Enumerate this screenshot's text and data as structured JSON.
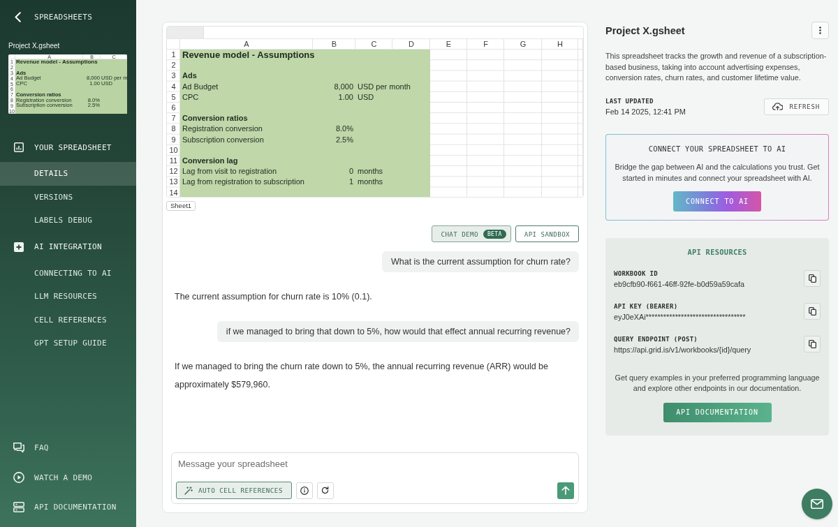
{
  "sidebar": {
    "back_link": "SPREADSHEETS",
    "file_name": "Project X.gsheet",
    "thumbnail": {
      "columns": [
        "A",
        "B",
        "C"
      ],
      "rows": [
        {
          "number": "1",
          "kind": "title",
          "label": "Revenue model - Assumptions"
        },
        {
          "number": "2",
          "kind": "blank"
        },
        {
          "number": "3",
          "kind": "heading",
          "label": "Ads"
        },
        {
          "number": "4",
          "kind": "item",
          "label": "Ad Budget",
          "value": "8,000",
          "unit": "USD per m"
        },
        {
          "number": "5",
          "kind": "item",
          "label": "CPC",
          "value": "1.00",
          "unit": "USD"
        },
        {
          "number": "6",
          "kind": "blank"
        },
        {
          "number": "7",
          "kind": "heading",
          "label": "Conversion ratios"
        },
        {
          "number": "8",
          "kind": "item",
          "label": "Registration conversion",
          "value": "8.0%"
        },
        {
          "number": "9",
          "kind": "item",
          "label": "Subscription conversion",
          "value": "2.5%"
        },
        {
          "number": "10",
          "kind": "blank"
        }
      ]
    },
    "sections": [
      {
        "label": "YOUR SPREADSHEET",
        "children": [
          {
            "label": "DETAILS",
            "selected": true
          },
          {
            "label": "VERSIONS",
            "selected": false
          },
          {
            "label": "LABELS DEBUG",
            "selected": false
          }
        ]
      },
      {
        "label": "AI INTEGRATION",
        "children": [
          {
            "label": "CONNECTING TO AI",
            "selected": false
          },
          {
            "label": "LLM RESOURCES",
            "selected": false
          },
          {
            "label": "CELL REFERENCES",
            "selected": false
          },
          {
            "label": "GPT SETUP GUIDE",
            "selected": false
          }
        ]
      }
    ],
    "footer_links": [
      {
        "label": "FAQ"
      },
      {
        "label": "WATCH A DEMO"
      },
      {
        "label": "API DOCUMENTATION"
      }
    ]
  },
  "sheet": {
    "columns": [
      "A",
      "B",
      "C",
      "D",
      "E",
      "F",
      "G",
      "H"
    ],
    "rows": [
      {
        "number": "1",
        "kind": "title",
        "label": "Revenue model - Assumptions"
      },
      {
        "number": "2",
        "kind": "blank"
      },
      {
        "number": "3",
        "kind": "heading",
        "label": "Ads"
      },
      {
        "number": "4",
        "kind": "item",
        "label": "Ad Budget",
        "value": "8,000",
        "unit": "USD per month"
      },
      {
        "number": "5",
        "kind": "item",
        "label": "CPC",
        "value": "1.00",
        "unit": "USD"
      },
      {
        "number": "6",
        "kind": "blank"
      },
      {
        "number": "7",
        "kind": "heading",
        "label": "Conversion ratios"
      },
      {
        "number": "8",
        "kind": "item",
        "label": "Registration conversion",
        "value": "8.0%"
      },
      {
        "number": "9",
        "kind": "item",
        "label": "Subscription conversion",
        "value": "2.5%"
      },
      {
        "number": "10",
        "kind": "blank"
      },
      {
        "number": "11",
        "kind": "heading",
        "label": "Conversion lag"
      },
      {
        "number": "12",
        "kind": "item",
        "label": "Lag from visit to registration",
        "value": "0",
        "unit": "months"
      },
      {
        "number": "13",
        "kind": "item",
        "label": "Lag from registration to subscription",
        "value": "1",
        "unit": "months"
      },
      {
        "number": "14",
        "kind": "blank"
      }
    ],
    "sheet_tab": "Sheet1"
  },
  "chat": {
    "modes": [
      {
        "label": "CHAT DEMO",
        "badge": "BETA",
        "selected": true
      },
      {
        "label": "API SANDBOX",
        "selected": false
      }
    ],
    "messages": [
      {
        "kind": "user",
        "text": "What is the current assumption for churn rate?"
      },
      {
        "kind": "assistant",
        "text": "The current assumption for churn rate is 10% (0.1)."
      },
      {
        "kind": "user",
        "text": "if we managed to bring that down to 5%, how would that effect annual recurring revenue?"
      },
      {
        "kind": "assistant",
        "text": "If we managed to bring the churn rate down to 5%, the annual recurring revenue (ARR) would be approximately $579,960."
      }
    ],
    "composer": {
      "placeholder": "Message your spreadsheet",
      "auto_references": {
        "label": "AUTO CELL REFERENCES",
        "on": true
      }
    }
  },
  "details": {
    "title": "Project X.gsheet",
    "description": "This spreadsheet tracks the growth and revenue of a subscription-based business, taking into account advertising expenses, conversion rates, churn rates, and customer lifetime value.",
    "last_updated": {
      "label": "LAST UPDATED",
      "value": "Feb 14 2025, 12:41 PM"
    },
    "refresh_button": "REFRESH",
    "connect_card": {
      "title": "CONNECT YOUR SPREADSHEET TO AI",
      "text": "Bridge the gap between AI and the calculations you trust. Get started in minutes and connect your spreadsheet with AI.",
      "button": "CONNECT TO AI"
    },
    "api_resources": {
      "title": "API RESOURCES",
      "items": [
        {
          "label": "WORKBOOK ID",
          "value": "eb9cfb90-f661-46ff-92fe-b0d59a59cafa"
        },
        {
          "label": "API KEY (BEARER)",
          "value": "eyJ0eXAi**********************************"
        },
        {
          "label": "QUERY ENDPOINT (POST)",
          "value": "https://api.grid.is/v1/workbooks/{id}/query"
        }
      ],
      "note": "Get query examples in your preferred programming language and explore other endpoints in our documentation.",
      "button": "API DOCUMENTATION"
    }
  }
}
